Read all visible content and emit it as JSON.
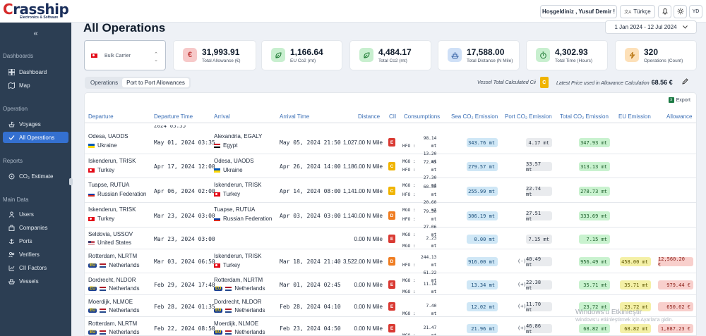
{
  "app": {
    "brand_prefix": "C",
    "brand_rest": "rasship",
    "brand_tagline": "Electronics & Software"
  },
  "sidebar": {
    "collapse_icon": "«",
    "sections": {
      "dashboards": "Dashboards",
      "operation": "Operation",
      "reports": "Reports",
      "main_data": "Main Data"
    },
    "items": [
      {
        "label": "Dashboard",
        "icon": "dashboard-icon"
      },
      {
        "label": "Map",
        "icon": "map-icon"
      },
      {
        "label": "Voyages",
        "icon": "voyages-icon"
      },
      {
        "label": "All Operations",
        "icon": "operations-icon",
        "active": true
      },
      {
        "label": "CO₂ Estimate",
        "icon": "co2-icon"
      },
      {
        "label": "Users",
        "icon": "users-icon"
      },
      {
        "label": "Companies",
        "icon": "companies-icon"
      },
      {
        "label": "Ports",
        "icon": "ports-icon"
      },
      {
        "label": "Verifiers",
        "icon": "verifiers-icon"
      },
      {
        "label": "CII Factors",
        "icon": "cii-factors-icon"
      },
      {
        "label": "Vessels",
        "icon": "vessels-icon"
      }
    ]
  },
  "topbar": {
    "greeting": "Hoşgeldiniz , Yusuf Demir !",
    "language": "Türkçe",
    "avatar_initials": "YD"
  },
  "page": {
    "title": "All Operations",
    "date_range": "1 Jan 2024 - 12 Jul 2024"
  },
  "vessel_selector": {
    "value": "Bulk Carrier"
  },
  "stats": [
    {
      "value": "31,993.91",
      "label": "Total Allowance (€)",
      "icon": "euro-icon",
      "color": "#f7c9c9"
    },
    {
      "value": "1,166.64",
      "label": "EU Co2 (mt)",
      "icon": "leaf-icon",
      "color": "#c8efcf"
    },
    {
      "value": "4,484.17",
      "label": "Total Co2 (mt)",
      "icon": "leaf-icon",
      "color": "#c8efcf"
    },
    {
      "value": "17,588.00",
      "label": "Total Distance (N Mile)",
      "icon": "ship-icon",
      "color": "#cfe0f7"
    },
    {
      "value": "4,302.93",
      "label": "Total Time (Hours)",
      "icon": "stopwatch-icon",
      "color": "#c8efcf"
    },
    {
      "value": "320",
      "label": "Operations (Count)",
      "icon": "bolt-icon",
      "color": "#fde0b8"
    }
  ],
  "tabs": [
    "Operations",
    "Port to Port Allowances"
  ],
  "cii_summary": {
    "label": "Vessel Total Calculated Cii",
    "grade": "C"
  },
  "latest_price": {
    "label": "Latest Price used in Allowance Calculation",
    "value": "68.56 €"
  },
  "export_label": "Export",
  "table": {
    "headers": [
      "Departure",
      "Departure Time",
      "Arrival",
      "Arrival Time",
      "Distance",
      "CII",
      "Consumptions",
      "Sea CO₂ Emission",
      "Port CO₂ Emission",
      "Total CO₂ Emission",
      "EU Emission",
      "Allowance"
    ],
    "partial_top_row": {
      "departure_time": "2024 03:35"
    },
    "rows": [
      {
        "dep": "Odesa, UAODS",
        "dep_country": "Ukraine",
        "dep_flag": "ua",
        "dep_time": "May 01, 2024 03:35",
        "arr": "Alexandria, EGALY",
        "arr_country": "Egypt",
        "arr_flag": "eg",
        "arr_time": "May 05, 2024 21:50",
        "distance": "1,027.00 N Mile",
        "cii": "E",
        "cons": [
          [
            "HFO",
            "98.14 mt"
          ],
          [
            "MGO",
            "13.20 mt"
          ]
        ],
        "sea": "343.76 mt",
        "port_sign": "",
        "port": "4.17 mt",
        "total": "347.93 mt",
        "eu": "",
        "allow": ""
      },
      {
        "dep": "Iskenderun, TRISK",
        "dep_country": "Turkey",
        "dep_flag": "tr",
        "dep_time": "Apr 17, 2024 12:00",
        "arr": "Odesa, UAODS",
        "arr_country": "Ukraine",
        "arr_flag": "ua",
        "arr_time": "Apr 26, 2024 14:00",
        "distance": "1,186.00 N Mile",
        "cii": "C",
        "cons": [
          [
            "HFO",
            "72.45 mt"
          ],
          [
            "MGO",
            "27.30 mt"
          ]
        ],
        "sea": "279.57 mt",
        "port_sign": "",
        "port": "33.57 mt",
        "total": "313.13 mt",
        "eu": "",
        "allow": ""
      },
      {
        "dep": "Tuapse, RUTUA",
        "dep_country": "Russian Federation",
        "dep_flag": "ru",
        "dep_time": "Apr 06, 2024 02:00",
        "arr": "Iskenderun, TRISK",
        "arr_country": "Turkey",
        "arr_flag": "tr",
        "arr_time": "Apr 14, 2024 08:00",
        "distance": "1,141.00 N Mile",
        "cii": "C",
        "cons": [
          [
            "HFO",
            "68.30 mt"
          ],
          [
            "MGO",
            "20.60 mt"
          ]
        ],
        "sea": "255.99 mt",
        "port_sign": "",
        "port": "22.74 mt",
        "total": "278.73 mt",
        "eu": "",
        "allow": ""
      },
      {
        "dep": "Iskenderun, TRISK",
        "dep_country": "Turkey",
        "dep_flag": "tr",
        "dep_time": "Mar 23, 2024 03:00",
        "arr": "Tuapse, RUTUA",
        "arr_country": "Russian Federation",
        "arr_flag": "ru",
        "arr_time": "Apr 03, 2024 03:00",
        "distance": "1,140.00 N Mile",
        "cii": "D",
        "cons": [
          [
            "HFO",
            "79.30 mt"
          ],
          [
            "MGO",
            "27.06 mt"
          ]
        ],
        "sea": "306.19 mt",
        "port_sign": "",
        "port": "27.51 mt",
        "total": "333.69 mt",
        "eu": "",
        "allow": ""
      },
      {
        "dep": "Seldovia, USSOV",
        "dep_country": "United States",
        "dep_flag": "us",
        "dep_time": "Mar 23, 2024 03:00",
        "arr": "",
        "arr_country": "",
        "arr_flag": "",
        "arr_time": "",
        "distance": "0.00 N Mile",
        "cii": "E",
        "cons": [
          [
            "MGO",
            "2.23 mt"
          ]
        ],
        "sea": "0.00 mt",
        "port_sign": "",
        "port": "7.15 mt",
        "total": "7.15 mt",
        "eu": "",
        "allow": ""
      },
      {
        "dep": "Rotterdam, NLRTM",
        "dep_country": "Netherlands",
        "dep_flag": "nl",
        "dep_eu": "EU",
        "dep_time": "Mar 03, 2024 06:50",
        "arr": "Iskenderun, TRISK",
        "arr_country": "Turkey",
        "arr_flag": "tr",
        "arr_time": "Mar 18, 2024 21:40",
        "distance": "3,522.00 N Mile",
        "cii": "D",
        "cons": [
          [
            "HFO",
            "244.13 mt"
          ],
          [
            "MGO",
            "61.22 mt"
          ]
        ],
        "sea": "916.00 mt",
        "port_sign": "(-)",
        "port": "40.49 mt",
        "total": "956.49 mt",
        "eu": "458.00 mt",
        "allow": "12,560.20 €"
      },
      {
        "dep": "Dordrecht, NLDOR",
        "dep_country": "Netherlands",
        "dep_flag": "nl",
        "dep_eu": "EU",
        "dep_time": "Feb 29, 2024 17:40",
        "arr": "Rotterdam, NLRTM",
        "arr_country": "Netherlands",
        "arr_flag": "nl",
        "arr_eu": "EU",
        "arr_time": "Mar 01, 2024 02:45",
        "distance": "0.00 N Mile",
        "cii": "E",
        "cons": [
          [
            "MGO",
            "11.14 mt"
          ]
        ],
        "sea": "13.34 mt",
        "port_sign": "(+)",
        "port": "22.38 mt",
        "total": "35.71 mt",
        "eu": "35.71 mt",
        "allow": "979.44 €"
      },
      {
        "dep": "Moerdijk, NLMOE",
        "dep_country": "Netherlands",
        "dep_flag": "nl",
        "dep_eu": "EU",
        "dep_time": "Feb 28, 2024 01:35",
        "arr": "Dordrecht, NLDOR",
        "arr_country": "Netherlands",
        "arr_flag": "nl",
        "arr_eu": "EU",
        "arr_time": "Feb 28, 2024 04:10",
        "distance": "0.00 N Mile",
        "cii": "E",
        "cons": [
          [
            "MGO",
            "7.40 mt"
          ]
        ],
        "sea": "12.02 mt",
        "port_sign": "(+)",
        "port": "11.70 mt",
        "total": "23.72 mt",
        "eu": "23.72 mt",
        "allow": "650.62 €"
      },
      {
        "dep": "Rotterdam, NLRTM",
        "dep_country": "Netherlands",
        "dep_flag": "nl",
        "dep_eu": "EU",
        "dep_time": "Feb 22, 2024 08:50",
        "arr": "Moerdijk, NLMOE",
        "arr_country": "Netherlands",
        "arr_flag": "nl",
        "arr_eu": "EU",
        "arr_time": "Feb 23, 2024 04:50",
        "distance": "0.00 N Mile",
        "cii": "E",
        "cons": [
          [
            "MGO",
            "21.47 mt"
          ]
        ],
        "sea": "21.96 mt",
        "port_sign": "(+)",
        "port": "46.86 mt",
        "total": "68.82 mt",
        "eu": "68.82 mt",
        "allow": "1,887.23 €"
      }
    ]
  },
  "cii_colors": {
    "C": "#f0b400",
    "D": "#ef7d22",
    "E": "#d93a33"
  },
  "watermark": {
    "line1": "Windows'u Etkinleştir",
    "line2": "Windows'u etkinleştirmek için Ayarlar'a gidin."
  }
}
